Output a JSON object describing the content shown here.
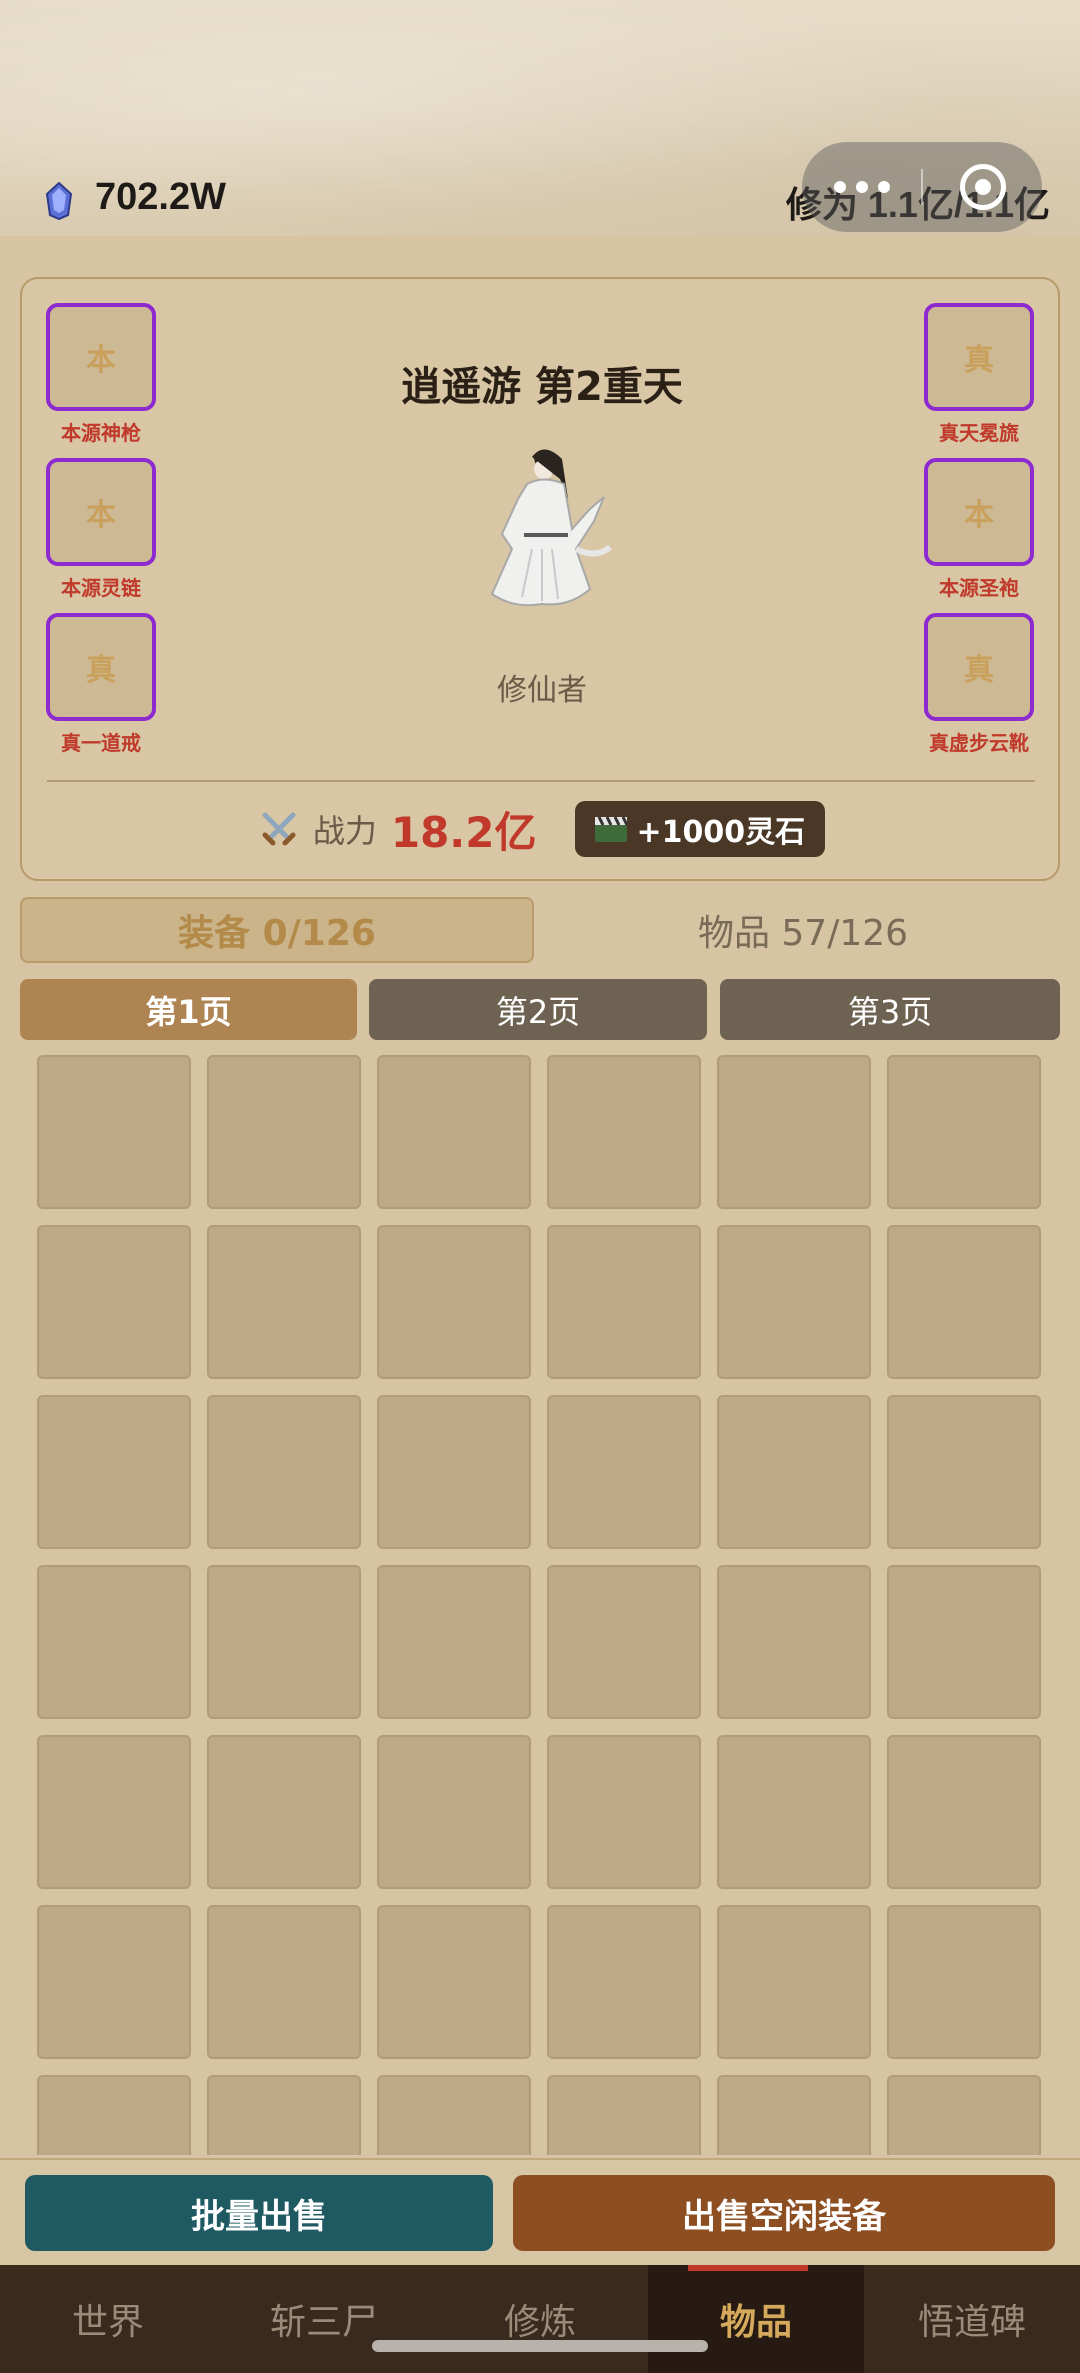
{
  "header": {
    "spirit_stone_icon": "blue-crystal-icon",
    "spirit_stones": "702.2W",
    "cultivation": "修为 1.1亿/1.1亿"
  },
  "panel": {
    "realm_title": "逍遥游 第2重天",
    "role_name": "修仙者",
    "power_label": "战力",
    "power_value": "18.2亿",
    "ad_reward_label": "+1000灵石",
    "left_slots": [
      {
        "glyph": "本",
        "label": "本源神枪"
      },
      {
        "glyph": "本",
        "label": "本源灵链"
      },
      {
        "glyph": "真",
        "label": "真一道戒"
      }
    ],
    "right_slots": [
      {
        "glyph": "真",
        "label": "真天冕旒"
      },
      {
        "glyph": "本",
        "label": "本源圣袍"
      },
      {
        "glyph": "真",
        "label": "真虚步云靴"
      }
    ],
    "slot_border_color": "#8d2ad0",
    "slot_label_color": "#c0392b"
  },
  "tabs": {
    "equip": "装备 0/126",
    "items": "物品 57/126"
  },
  "pages": [
    "第1页",
    "第2页",
    "第3页"
  ],
  "actions": {
    "batch_sell": "批量出售",
    "sell_idle": "出售空闲装备"
  },
  "nav": [
    "世界",
    "斩三尸",
    "修炼",
    "物品",
    "悟道碑"
  ]
}
